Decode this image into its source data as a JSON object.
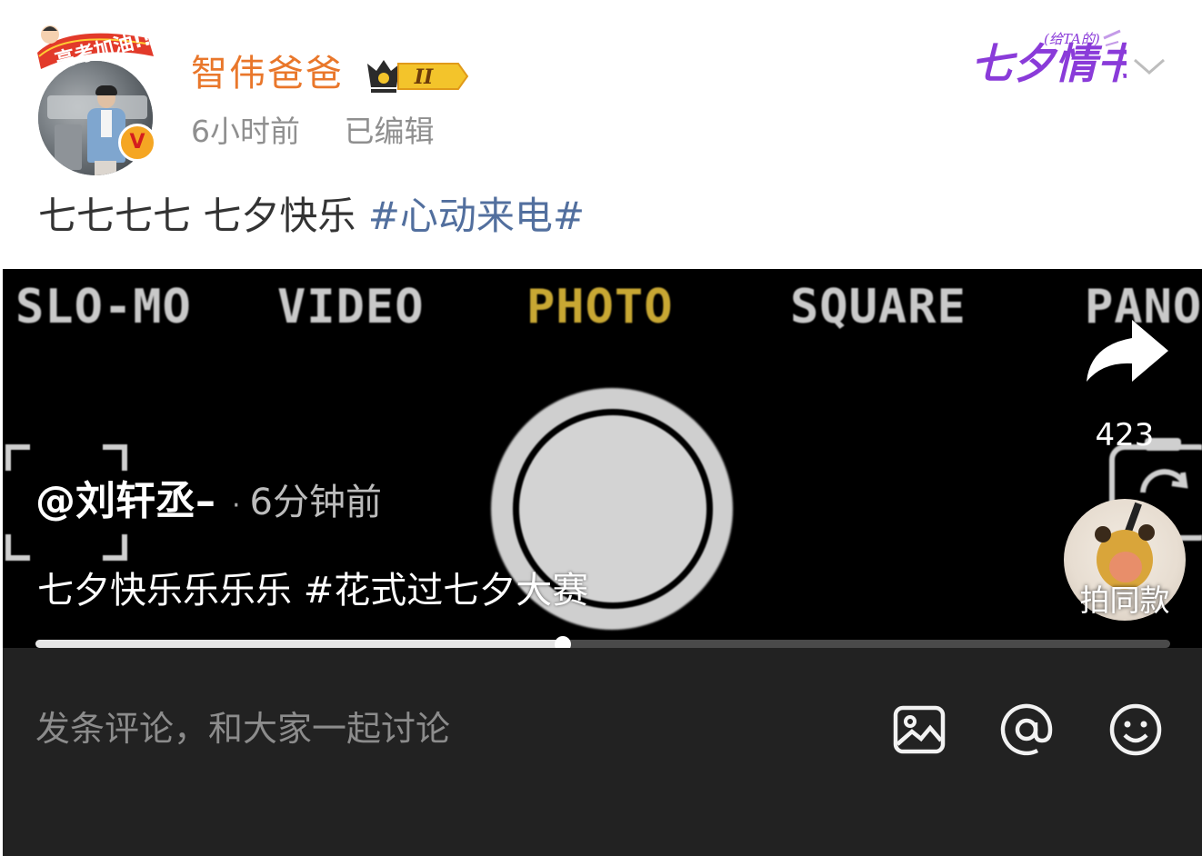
{
  "post": {
    "avatar_banner_text": "高考加油!!",
    "username": "智伟爸爸",
    "member_level": "II",
    "time_ago": "6小时前",
    "edited_label": "已编辑",
    "promo_text": "七夕情书",
    "promo_subtext": "(给TA的)",
    "text_plain": "七七七七 七夕快乐 ",
    "text_hashtag": "#心动来电#"
  },
  "video": {
    "camera_modes": [
      "SLO-MO",
      "VIDEO",
      "PHOTO",
      "SQUARE",
      "PANO"
    ],
    "active_mode": "PHOTO",
    "share_count": "423",
    "mention_name": "@刘轩丞–",
    "mention_separator": "·",
    "mention_time": "6分钟前",
    "caption": "七夕快乐乐乐乐 #花式过七夕大赛",
    "same_style_label": "拍同款",
    "progress": 0.465
  },
  "comment_bar": {
    "placeholder": "发条评论，和大家一起讨论",
    "icons": [
      "image-icon",
      "at-icon",
      "emoji-icon"
    ]
  },
  "colors": {
    "username": "#e9772b",
    "hashtag": "#526f9e",
    "active_mode": "#c8a733",
    "comment_bar_bg": "#222222",
    "promo_purple": "#8a3bd9"
  }
}
